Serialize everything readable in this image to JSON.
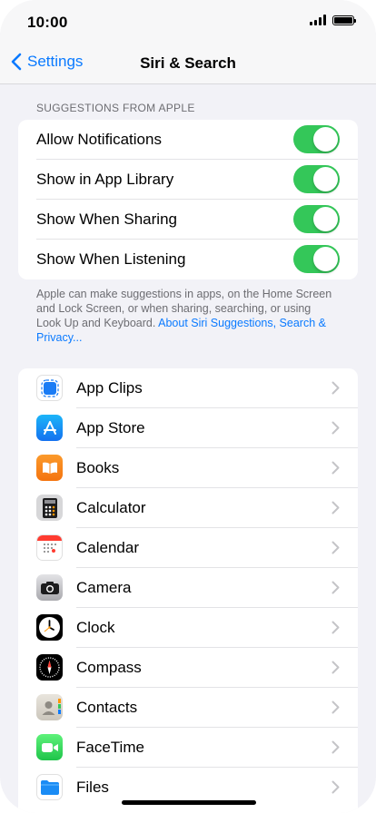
{
  "status": {
    "time": "10:00"
  },
  "nav": {
    "back_label": "Settings",
    "title": "Siri & Search"
  },
  "suggestions": {
    "header": "SUGGESTIONS FROM APPLE",
    "toggles": [
      {
        "label": "Allow Notifications",
        "on": true
      },
      {
        "label": "Show in App Library",
        "on": true
      },
      {
        "label": "Show When Sharing",
        "on": true
      },
      {
        "label": "Show When Listening",
        "on": true
      }
    ],
    "note": "Apple can make suggestions in apps, on the Home Screen and Lock Screen, or when sharing, searching, or using Look Up and Keyboard.",
    "note_link": "About Siri Suggestions, Search & Privacy..."
  },
  "apps": [
    {
      "label": "App Clips",
      "icon": "app-clips-icon"
    },
    {
      "label": "App Store",
      "icon": "app-store-icon"
    },
    {
      "label": "Books",
      "icon": "books-icon"
    },
    {
      "label": "Calculator",
      "icon": "calculator-icon"
    },
    {
      "label": "Calendar",
      "icon": "calendar-icon"
    },
    {
      "label": "Camera",
      "icon": "camera-icon"
    },
    {
      "label": "Clock",
      "icon": "clock-icon"
    },
    {
      "label": "Compass",
      "icon": "compass-icon"
    },
    {
      "label": "Contacts",
      "icon": "contacts-icon"
    },
    {
      "label": "FaceTime",
      "icon": "facetime-icon"
    },
    {
      "label": "Files",
      "icon": "files-icon"
    }
  ],
  "colors": {
    "accent": "#0a7aff",
    "toggle_on": "#34c759",
    "background": "#f2f2f7"
  }
}
